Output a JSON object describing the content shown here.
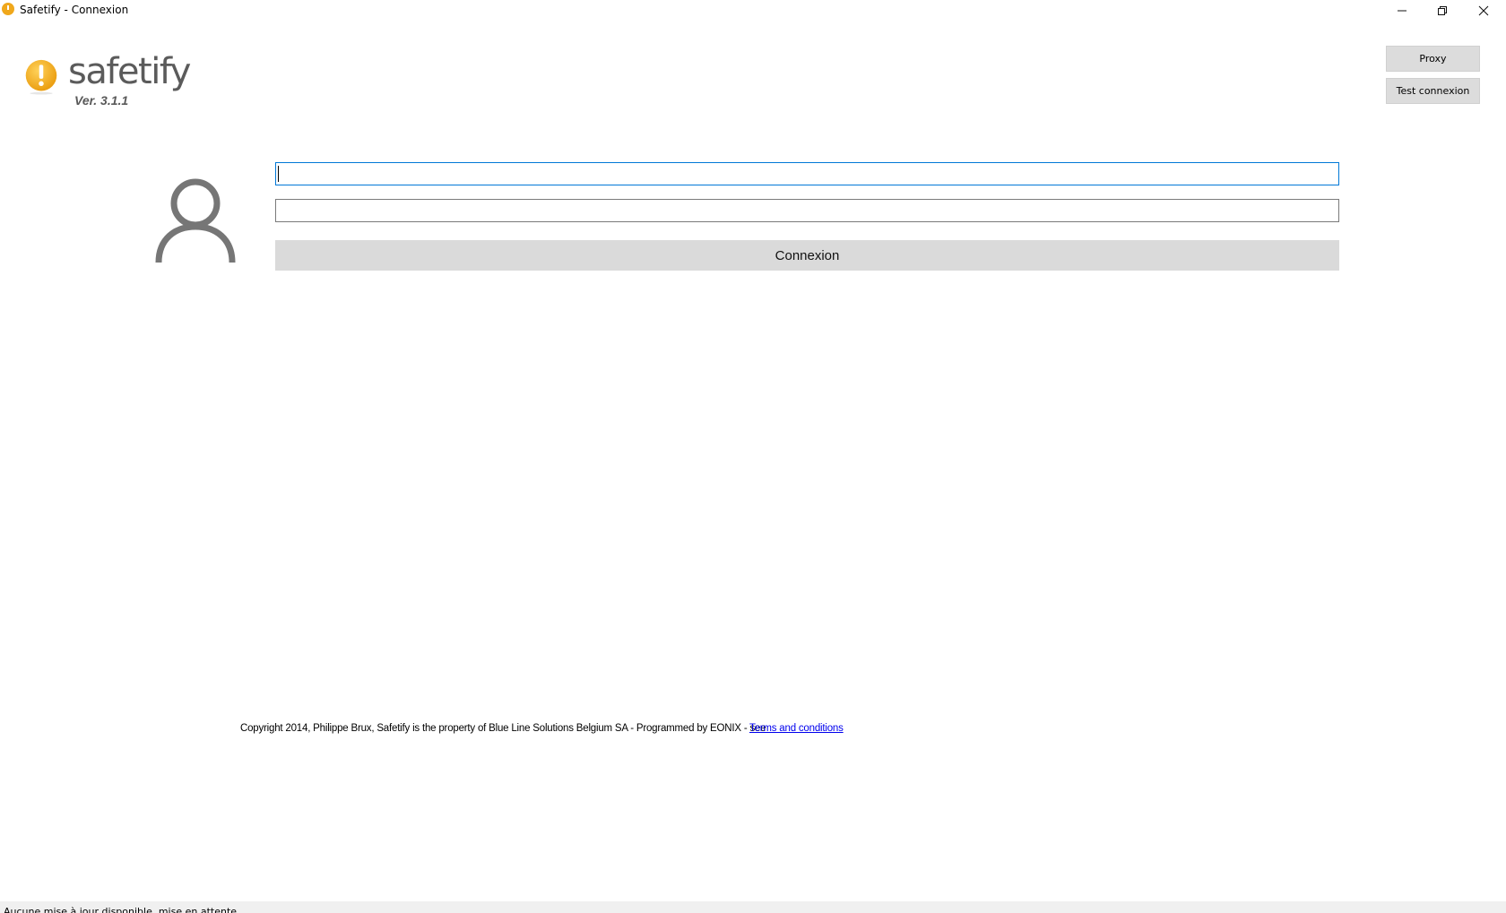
{
  "window": {
    "title": "Safetify - Connexion"
  },
  "logo": {
    "text": "safetify",
    "version": "Ver. 3.1.1",
    "badge_color": "#f0a81c"
  },
  "side_buttons": {
    "proxy_label": "Proxy",
    "test_label": "Test connexion"
  },
  "login": {
    "username_value": "",
    "password_value": "",
    "connect_label": "Connexion",
    "avatar_icon": "user-icon"
  },
  "footer": {
    "copyright": "Copyright 2014, Philippe Brux, Safetify is the property of Blue Line Solutions Belgium SA - Programmed by EONIX - see",
    "terms_link": "Terms and conditions"
  },
  "status": {
    "text": "Aucune mise à jour disponible, mise en attente."
  },
  "colors": {
    "accent": "#0078d7",
    "button_bg": "#dadada",
    "link": "#0000ee"
  }
}
